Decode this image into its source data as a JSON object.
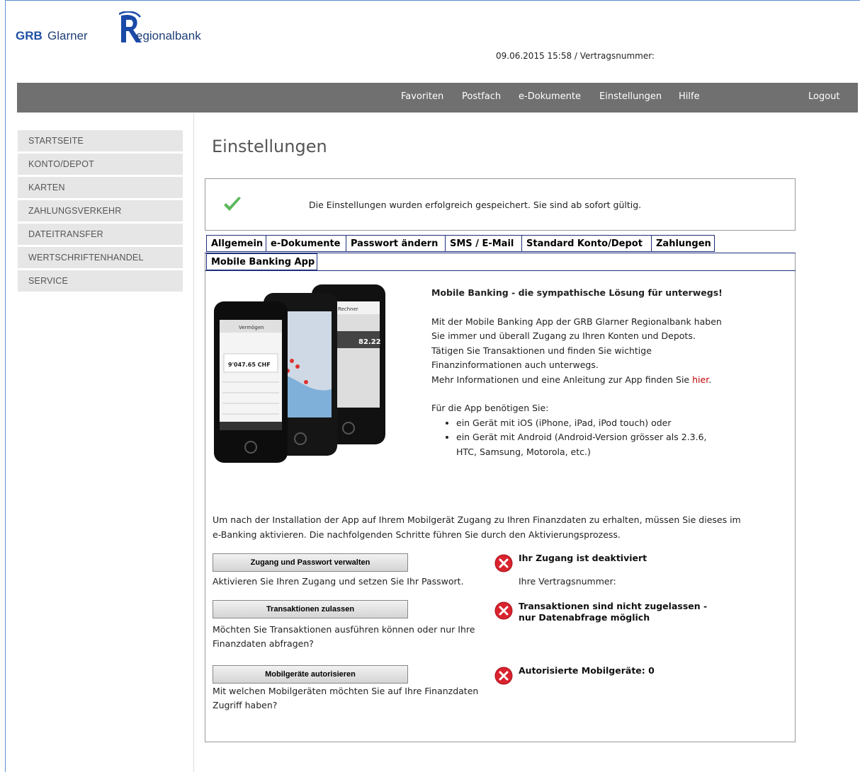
{
  "brand": {
    "grb": "GRB",
    "glarner": "Glarner",
    "regionalbank": "egionalbank"
  },
  "header": {
    "meta": "09.06.2015 15:58 / Vertragsnummer:"
  },
  "topnav": {
    "favoriten": "Favoriten",
    "postfach": "Postfach",
    "edokumente": "e-Dokumente",
    "einstellungen": "Einstellungen",
    "hilfe": "Hilfe",
    "logout": "Logout"
  },
  "sidebar": {
    "items": [
      {
        "label": "STARTSEITE"
      },
      {
        "label": "KONTO/DEPOT"
      },
      {
        "label": "KARTEN"
      },
      {
        "label": "ZAHLUNGSVERKEHR"
      },
      {
        "label": "DATEITRANSFER"
      },
      {
        "label": "WERTSCHRIFTENHANDEL"
      },
      {
        "label": "SERVICE"
      }
    ]
  },
  "page": {
    "title": "Einstellungen"
  },
  "notice": {
    "message": "Die Einstellungen wurden erfolgreich gespeichert. Sie sind ab sofort gültig."
  },
  "tabs": [
    {
      "label": "Allgemein"
    },
    {
      "label": "e-Dokumente"
    },
    {
      "label": "Passwort ändern"
    },
    {
      "label": "SMS / E-Mail"
    },
    {
      "label": "Standard Konto/Depot"
    },
    {
      "label": "Zahlungen"
    },
    {
      "label": "Mobile Banking App"
    }
  ],
  "phone": {
    "screen1_title": "Vermögen",
    "screen1_amount": "9'047.65 CHF",
    "screen3_title": "Rechner",
    "screen3_value": "82.22"
  },
  "intro": {
    "headline": "Mobile Banking - die sympathische Lösung für unterwegs!",
    "p1": "Mit der Mobile Banking App der GRB Glarner Regionalbank haben Sie immer und überall Zugang zu Ihren Konten und Depots. Tätigen Sie Transaktionen und finden Sie wichtige Finanzinformationen auch unterwegs.",
    "p2": "Mehr Informationen und eine Anleitung zur App finden Sie",
    "link": "hier",
    "requirements": "Für die App benötigen Sie:",
    "req_items": [
      "ein Gerät mit iOS (iPhone, iPad, iPod touch) oder",
      "ein Gerät mit Android (Android-Version grösser als 2.3.6, HTC, Samsung, Motorola, etc.)"
    ]
  },
  "activation": {
    "text": "Um nach der Installation der App auf Ihrem Mobilgerät Zugang zu Ihren Finanzdaten zu erhalten, müssen Sie dieses im e-Banking aktivieren. Die nachfolgenden Schritte führen Sie durch den Aktivierungsprozess."
  },
  "steps": [
    {
      "button": "Zugang und Passwort verwalten",
      "desc": "Aktivieren Sie Ihren Zugang und setzen Sie Ihr Passwort.",
      "status": "Ihr Zugang ist deaktiviert",
      "sub": "Ihre Vertragsnummer:"
    },
    {
      "button": "Transaktionen zulassen",
      "desc": "Möchten Sie Transaktionen ausführen können oder nur Ihre Finanzdaten abfragen?",
      "status": "Transaktionen sind nicht zugelassen - nur Datenabfrage möglich"
    },
    {
      "button": "Mobilgeräte autorisieren",
      "desc": "Mit welchen Mobilgeräten möchten Sie auf Ihre Finanzdaten Zugriff haben?",
      "status": "Autorisierte Mobilgeräte: 0"
    }
  ],
  "colors": {
    "nav_bg": "#707070",
    "tab_border": "#1d2f7c",
    "link": "#c00000",
    "error": "#d9232e",
    "success": "#5cb85c"
  }
}
